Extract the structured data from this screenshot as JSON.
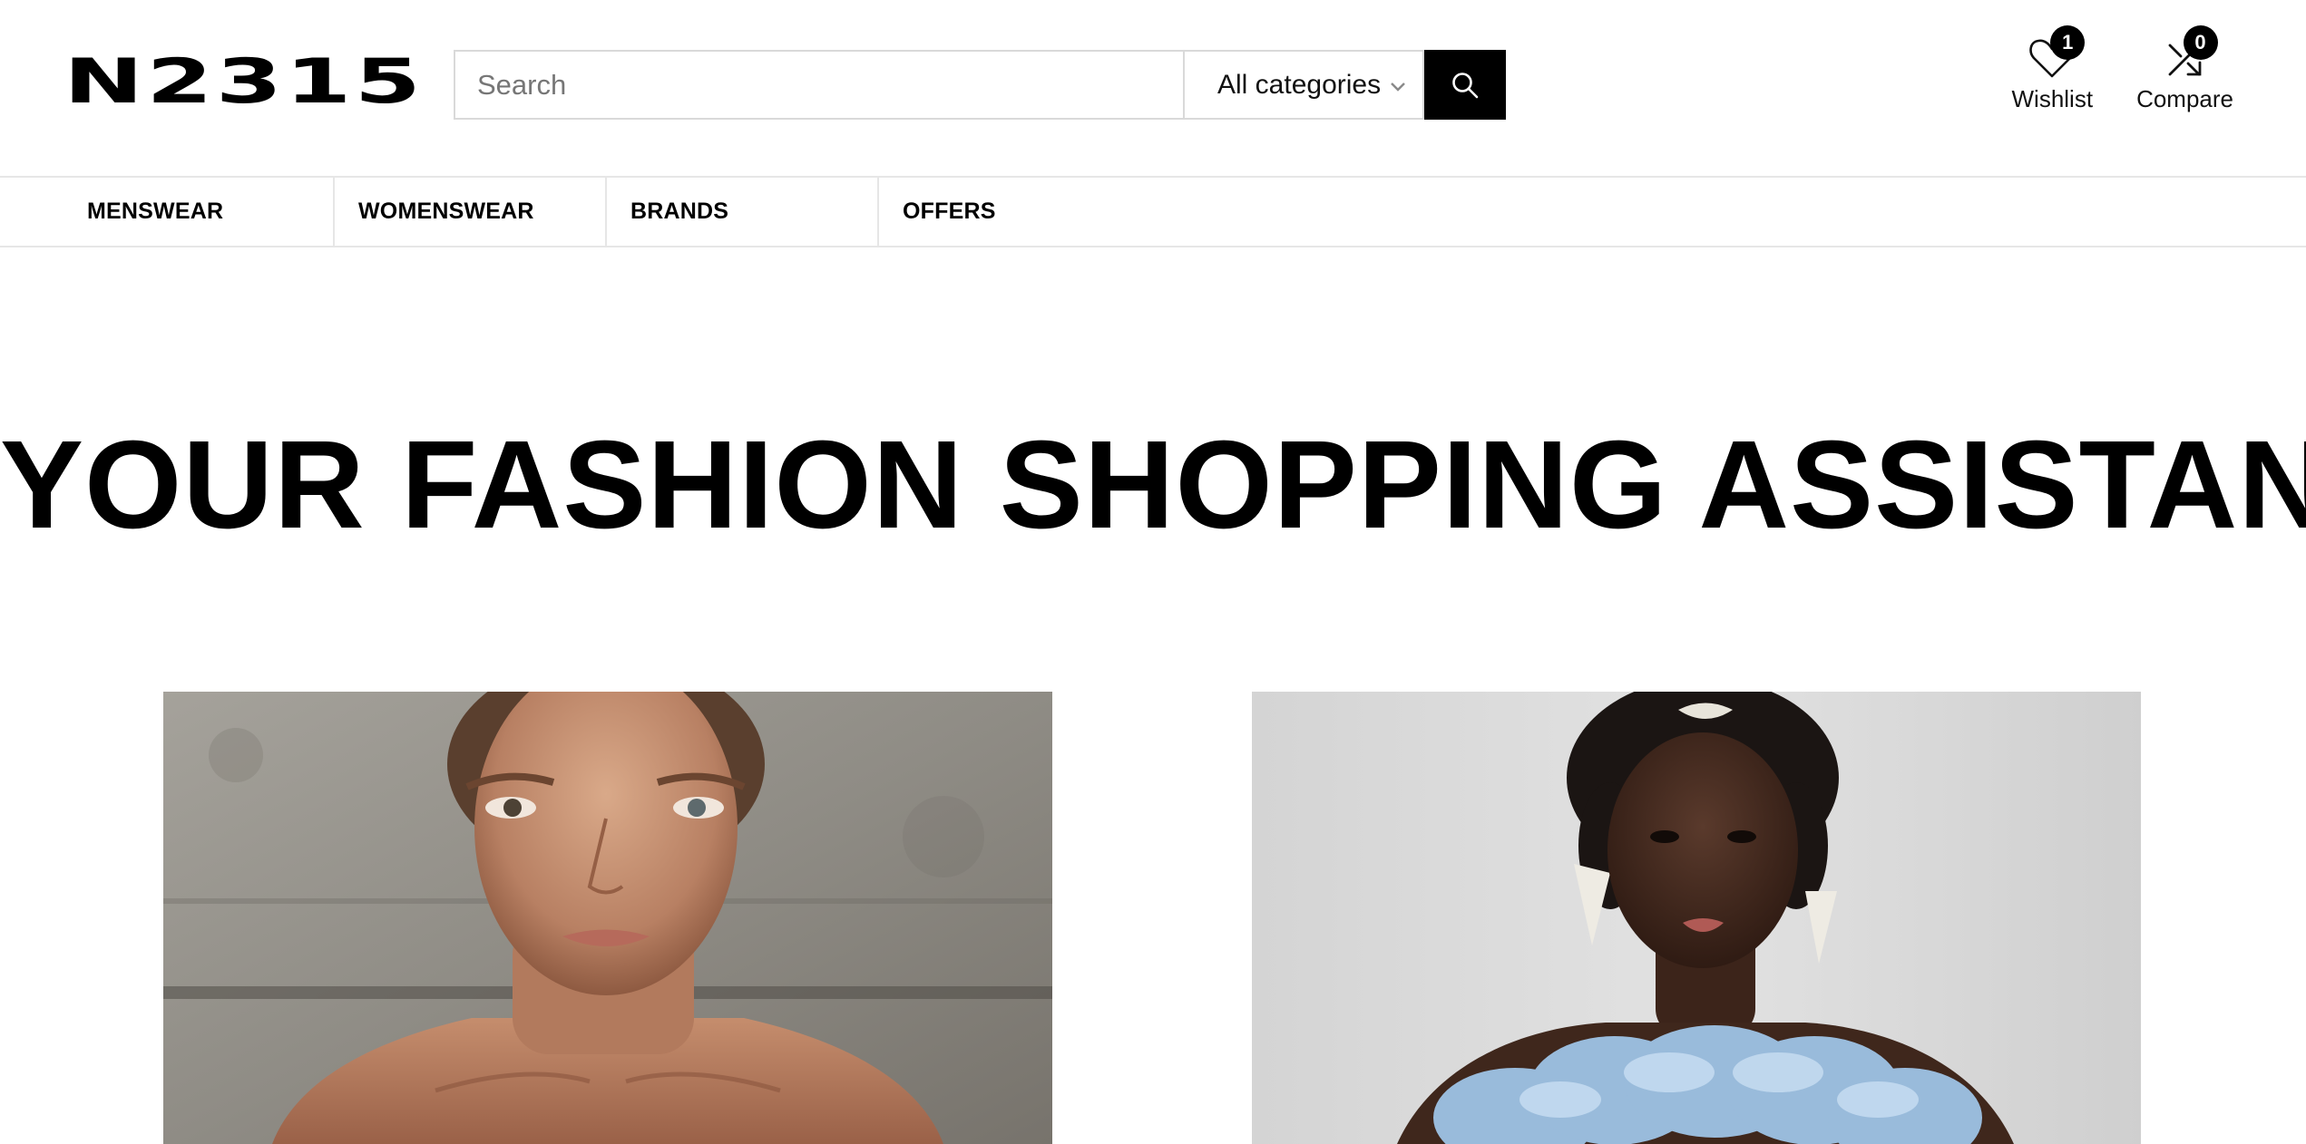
{
  "brand": {
    "logo_text": "N2315"
  },
  "search": {
    "placeholder": "Search",
    "category_selected": "All categories"
  },
  "header_actions": [
    {
      "label": "Wishlist",
      "count": "1",
      "icon": "heart-icon"
    },
    {
      "label": "Compare",
      "count": "0",
      "icon": "compare-arrows-icon"
    }
  ],
  "nav": {
    "items": [
      {
        "label": "MENSWEAR"
      },
      {
        "label": "WOMENSWEAR"
      },
      {
        "label": "BRANDS"
      },
      {
        "label": "OFFERS"
      }
    ]
  },
  "hero": {
    "title": "YOUR FASHION SHOPPING ASSISTANT"
  },
  "colors": {
    "primary": "#000000",
    "background": "#ffffff",
    "border": "#e6e6e6"
  }
}
